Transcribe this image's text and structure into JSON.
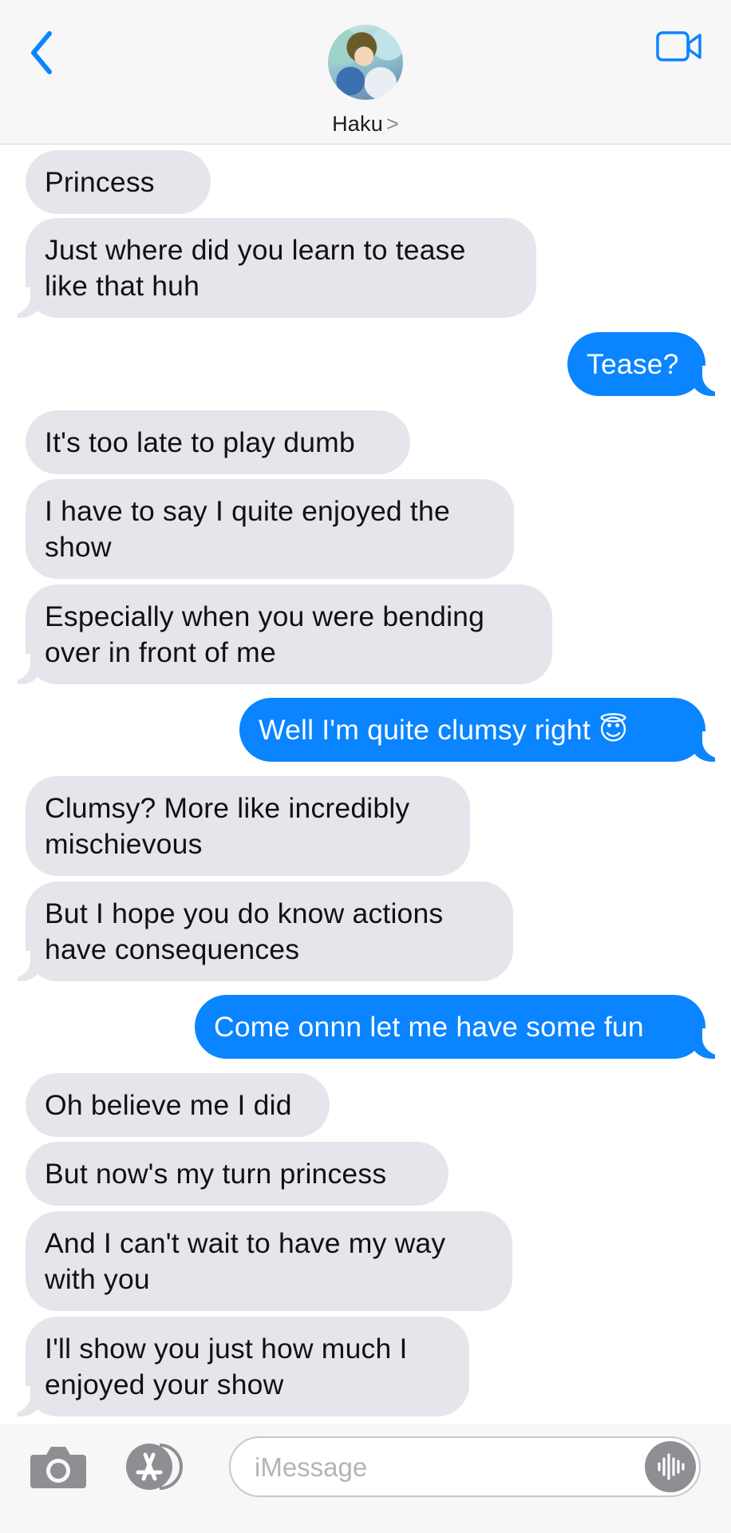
{
  "header": {
    "contact_name": "Haku",
    "name_chevron": ">",
    "icons": {
      "back": "chevron-left-icon",
      "video": "video-camera-icon"
    },
    "accent": "#0a84ff"
  },
  "messages": [
    {
      "dir": "in",
      "text": "Princess"
    },
    {
      "dir": "in",
      "text": "Just where did you learn to tease\nlike that huh"
    },
    {
      "dir": "out",
      "text": "Tease?"
    },
    {
      "dir": "in",
      "text": "It's too late to play dumb"
    },
    {
      "dir": "in",
      "text": "I have to say I quite enjoyed the\nshow"
    },
    {
      "dir": "in",
      "text": "Especially when you were bending\nover in front of me"
    },
    {
      "dir": "out",
      "text": "Well I'm quite clumsy right 😇"
    },
    {
      "dir": "in",
      "text": "Clumsy? More like incredibly\nmischievous"
    },
    {
      "dir": "in",
      "text": "But I hope you do know actions\nhave consequences"
    },
    {
      "dir": "out",
      "text": "Come onnn let me have some fun"
    },
    {
      "dir": "in",
      "text": "Oh believe me I did"
    },
    {
      "dir": "in",
      "text": "But now's my turn princess"
    },
    {
      "dir": "in",
      "text": "And I can't wait to have my way\nwith you"
    },
    {
      "dir": "in",
      "text": "I'll show you just how much I\nenjoyed your show"
    }
  ],
  "composer": {
    "placeholder": "iMessage",
    "icons": {
      "camera": "camera-icon",
      "apps": "app-store-icon",
      "audio": "audio-waveform-icon"
    }
  },
  "colors": {
    "incoming_bubble": "#e6e5eb",
    "outgoing_bubble": "#0a84ff",
    "background": "#ffffff"
  }
}
